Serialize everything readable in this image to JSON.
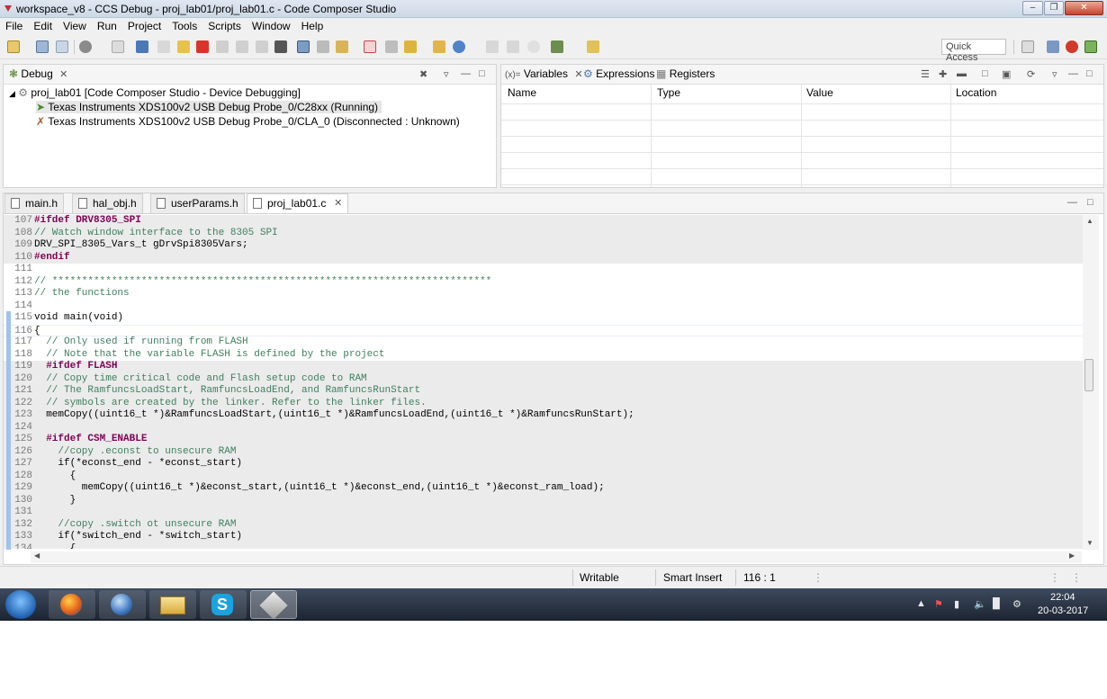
{
  "window": {
    "title": "workspace_v8 - CCS Debug - proj_lab01/proj_lab01.c - Code Composer Studio"
  },
  "menu": [
    "File",
    "Edit",
    "View",
    "Run",
    "Project",
    "Tools",
    "Scripts",
    "Window",
    "Help"
  ],
  "toolbar": {
    "quick_access": "Quick Access"
  },
  "debug_panel": {
    "tab_label": "Debug",
    "project": "proj_lab01 [Code Composer Studio - Device Debugging]",
    "probes": [
      "Texas Instruments XDS100v2 USB Debug Probe_0/C28xx (Running)",
      "Texas Instruments XDS100v2 USB Debug Probe_0/CLA_0 (Disconnected : Unknown)"
    ]
  },
  "variables_panel": {
    "tabs": [
      "Variables",
      "Expressions",
      "Registers"
    ],
    "tab_prefix": "(x)=",
    "columns": [
      "Name",
      "Type",
      "Value",
      "Location"
    ]
  },
  "editor": {
    "tabs": [
      "main.h",
      "hal_obj.h",
      "userParams.h",
      "proj_lab01.c"
    ],
    "active_tab": "proj_lab01.c",
    "lines": [
      {
        "n": "107",
        "t": "#ifdef DRV8305_SPI",
        "k": "pp",
        "bg": "shade"
      },
      {
        "n": "108",
        "t": "// Watch window interface to the 8305 SPI",
        "k": "cm",
        "bg": "shade"
      },
      {
        "n": "109",
        "t": "DRV_SPI_8305_Vars_t gDrvSpi8305Vars;",
        "k": "tx",
        "bg": "shade"
      },
      {
        "n": "110",
        "t": "#endif",
        "k": "pp",
        "bg": "shade"
      },
      {
        "n": "111",
        "t": "",
        "k": "tx",
        "bg": ""
      },
      {
        "n": "112",
        "t": "// **************************************************************************",
        "k": "cm",
        "bg": ""
      },
      {
        "n": "113",
        "t": "// the functions",
        "k": "cm",
        "bg": ""
      },
      {
        "n": "114",
        "t": "",
        "k": "tx",
        "bg": ""
      },
      {
        "n": "115",
        "t": "void main(void)",
        "k": "kw",
        "bg": ""
      },
      {
        "n": "116",
        "t": "{",
        "k": "tx",
        "bg": "cur"
      },
      {
        "n": "117",
        "t": "  // Only used if running from FLASH",
        "k": "cm",
        "bg": ""
      },
      {
        "n": "118",
        "t": "  // Note that the variable FLASH is defined by the project",
        "k": "cm",
        "bg": ""
      },
      {
        "n": "119",
        "t": "  #ifdef FLASH",
        "k": "pp",
        "bg": "shade"
      },
      {
        "n": "120",
        "t": "  // Copy time critical code and Flash setup code to RAM",
        "k": "cm",
        "bg": "shade"
      },
      {
        "n": "121",
        "t": "  // The RamfuncsLoadStart, RamfuncsLoadEnd, and RamfuncsRunStart",
        "k": "cm",
        "bg": "shade"
      },
      {
        "n": "122",
        "t": "  // symbols are created by the linker. Refer to the linker files.",
        "k": "cm",
        "bg": "shade"
      },
      {
        "n": "123",
        "t": "  memCopy((uint16_t *)&RamfuncsLoadStart,(uint16_t *)&RamfuncsLoadEnd,(uint16_t *)&RamfuncsRunStart);",
        "k": "tx",
        "bg": "shade"
      },
      {
        "n": "124",
        "t": "",
        "k": "tx",
        "bg": "shade"
      },
      {
        "n": "125",
        "t": "  #ifdef CSM_ENABLE",
        "k": "pp",
        "bg": "shade"
      },
      {
        "n": "126",
        "t": "    //copy .econst to unsecure RAM",
        "k": "cm",
        "bg": "shade"
      },
      {
        "n": "127",
        "t": "    if(*econst_end - *econst_start)",
        "k": "kw",
        "bg": "shade"
      },
      {
        "n": "128",
        "t": "      {",
        "k": "tx",
        "bg": "shade"
      },
      {
        "n": "129",
        "t": "        memCopy((uint16_t *)&econst_start,(uint16_t *)&econst_end,(uint16_t *)&econst_ram_load);",
        "k": "tx",
        "bg": "shade"
      },
      {
        "n": "130",
        "t": "      }",
        "k": "tx",
        "bg": "shade"
      },
      {
        "n": "131",
        "t": "",
        "k": "tx",
        "bg": "shade"
      },
      {
        "n": "132",
        "t": "    //copy .switch ot unsecure RAM",
        "k": "cm",
        "bg": "shade"
      },
      {
        "n": "133",
        "t": "    if(*switch_end - *switch_start)",
        "k": "kw",
        "bg": "shade"
      },
      {
        "n": "134",
        "t": "      {",
        "k": "tx",
        "bg": "shade"
      }
    ]
  },
  "status": {
    "writable": "Writable",
    "insert_mode": "Smart Insert",
    "position": "116 : 1"
  },
  "taskbar": {
    "time": "22:04",
    "date": "20-03-2017"
  },
  "colors": {
    "comment": "#3f7f5f",
    "preprocessor": "#7f0055",
    "shaded_line": "#ebebeb",
    "taskbar": "#2a3445"
  }
}
